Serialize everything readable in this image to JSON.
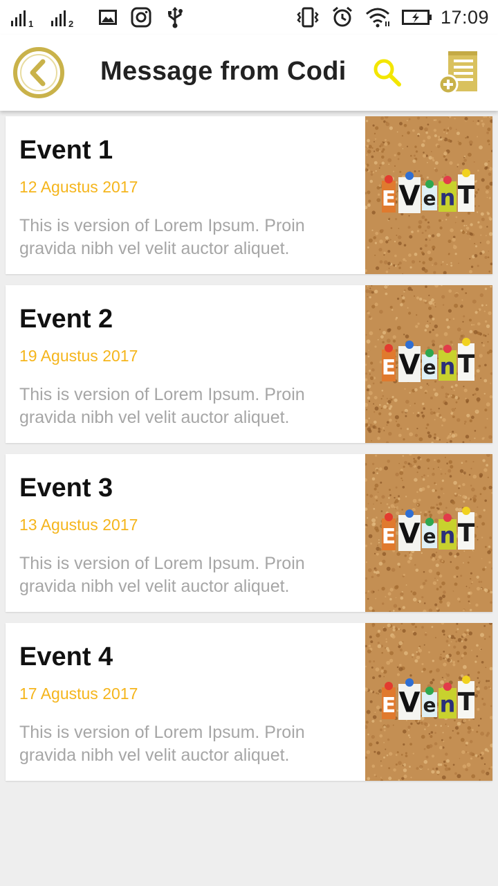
{
  "status_bar": {
    "sim1_label": "1",
    "sim2_label": "2",
    "time": "17:09"
  },
  "app_bar": {
    "title": "Message from Codi",
    "accent_color": "#c9b24a",
    "search_color": "#f3e600"
  },
  "events": [
    {
      "title": "Event 1",
      "date": "12 Agustus 2017",
      "description": "This is version of Lorem Ipsum. Proin gravida nibh vel velit auctor aliquet."
    },
    {
      "title": "Event 2",
      "date": "19 Agustus 2017",
      "description": "This is version of Lorem Ipsum. Proin gravida nibh vel velit auctor aliquet."
    },
    {
      "title": "Event 3",
      "date": "13 Agustus 2017",
      "description": "This is version of Lorem Ipsum. Proin gravida nibh vel velit auctor aliquet."
    },
    {
      "title": "Event 4",
      "date": "17 Agustus 2017",
      "description": "This is version of Lorem Ipsum. Proin gravida nibh vel velit auctor aliquet."
    }
  ],
  "thumbnail_letters": [
    "E",
    "V",
    "e",
    "n",
    "T"
  ]
}
